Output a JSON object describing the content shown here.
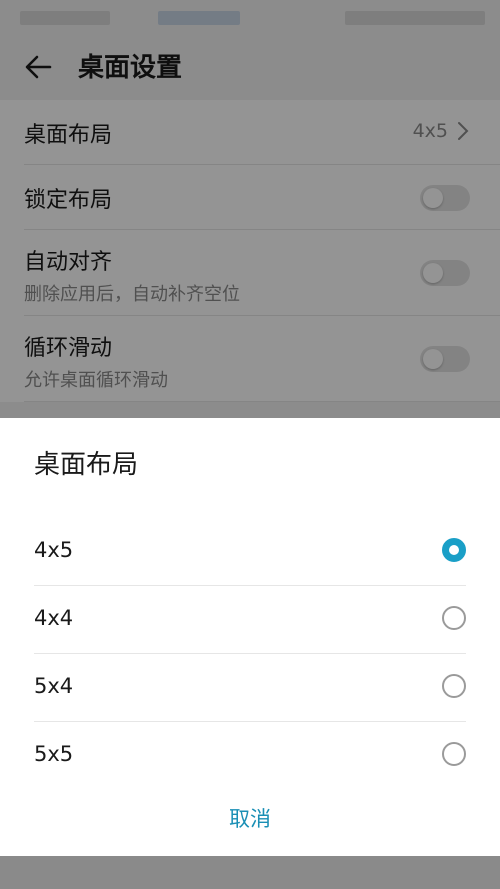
{
  "appbar": {
    "title": "桌面设置",
    "back_icon": "arrow-left-icon"
  },
  "settings": [
    {
      "label": "桌面布局",
      "value": "4x5",
      "type": "nav"
    },
    {
      "label": "锁定布局",
      "type": "toggle",
      "on": false
    },
    {
      "label": "自动对齐",
      "sub": "删除应用后，自动补齐空位",
      "type": "toggle",
      "on": false
    },
    {
      "label": "循环滑动",
      "sub": "允许桌面循环滑动",
      "type": "toggle",
      "on": false
    }
  ],
  "dialog": {
    "title": "桌面布局",
    "options": [
      {
        "label": "4x5",
        "selected": true
      },
      {
        "label": "4x4",
        "selected": false
      },
      {
        "label": "5x4",
        "selected": false
      },
      {
        "label": "5x5",
        "selected": false
      }
    ],
    "cancel_label": "取消"
  },
  "colors": {
    "accent": "#1a9fc7"
  }
}
